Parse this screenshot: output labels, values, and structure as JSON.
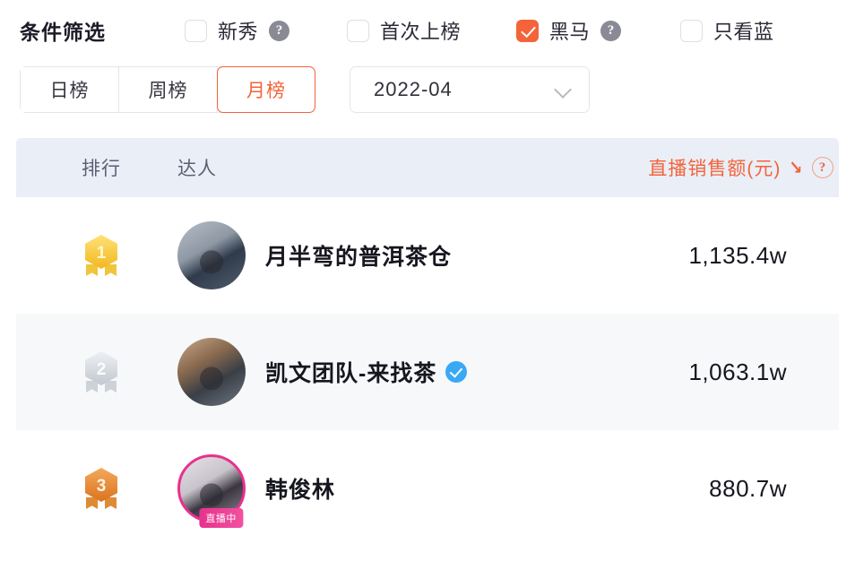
{
  "filter": {
    "title": "条件筛选",
    "checkboxes": [
      {
        "label": "新秀",
        "checked": false,
        "help": "?"
      },
      {
        "label": "首次上榜",
        "checked": false,
        "help": ""
      },
      {
        "label": "黑马",
        "checked": true,
        "help": "?"
      },
      {
        "label": "只看蓝",
        "checked": false,
        "help": ""
      }
    ]
  },
  "tabs": {
    "items": [
      {
        "label": "日榜",
        "active": false
      },
      {
        "label": "周榜",
        "active": false
      },
      {
        "label": "月榜",
        "active": true
      }
    ]
  },
  "date_select": {
    "value": "2022-04",
    "icon": "chevron-down-icon"
  },
  "table": {
    "headers": {
      "rank": "排行",
      "name": "达人",
      "sales": "直播销售额(元)",
      "sort_arrow": "↘",
      "help": "?"
    },
    "rows": [
      {
        "rank": "1",
        "medal": "gold",
        "name": "月半弯的普洱茶仓",
        "verified": false,
        "live": false,
        "live_label": "",
        "sales": "1,135.4w"
      },
      {
        "rank": "2",
        "medal": "silver",
        "name": "凯文团队-来找茶",
        "verified": true,
        "live": false,
        "live_label": "",
        "sales": "1,063.1w"
      },
      {
        "rank": "3",
        "medal": "bronze",
        "name": "韩俊林",
        "verified": false,
        "live": true,
        "live_label": "直播中",
        "sales": "880.7w"
      }
    ]
  },
  "colors": {
    "accent": "#f4633a",
    "header_bg": "#eaeef7",
    "verified": "#38a9f5",
    "live": "#e8318e"
  }
}
